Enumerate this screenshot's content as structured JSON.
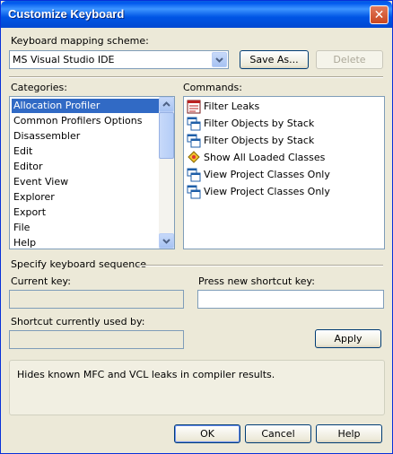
{
  "window": {
    "title": "Customize Keyboard",
    "close_glyph": "✕"
  },
  "mapping": {
    "label": "Keyboard mapping scheme:",
    "value": "MS Visual Studio IDE",
    "save_as_label": "Save As...",
    "delete_label": "Delete"
  },
  "categories": {
    "label": "Categories:",
    "items": [
      "Allocation Profiler",
      "Common Profilers Options",
      "Disassembler",
      "Edit",
      "Editor",
      "Event View",
      "Explorer",
      "Export",
      "File",
      "Help"
    ],
    "selected": "Allocation Profiler"
  },
  "commands": {
    "label": "Commands:",
    "items": [
      {
        "label": "Filter Leaks",
        "icon": "filter-leaks-icon"
      },
      {
        "label": "Filter Objects by Stack",
        "icon": "stack-windows-icon"
      },
      {
        "label": "Filter Objects by Stack",
        "icon": "stack-windows-icon"
      },
      {
        "label": "Show All Loaded Classes",
        "icon": "classes-icon"
      },
      {
        "label": "View Project Classes Only",
        "icon": "windows-icon"
      },
      {
        "label": "View Project Classes Only",
        "icon": "windows-icon"
      }
    ],
    "selected": "Filter Leaks"
  },
  "sequence": {
    "label": "Specify keyboard sequence",
    "current_key_label": "Current key:",
    "current_key_value": "",
    "new_key_label": "Press new shortcut key:",
    "new_key_value": "",
    "used_by_label": "Shortcut currently used by:",
    "used_by_value": "",
    "apply_label": "Apply"
  },
  "description": "Hides known MFC and VCL leaks in compiler results.",
  "footer": {
    "ok_label": "OK",
    "cancel_label": "Cancel",
    "help_label": "Help"
  },
  "colors": {
    "titlebar": "#0058ee",
    "dialog_bg": "#ece9d8",
    "selection": "#316ac5",
    "field_border": "#7f9db9"
  }
}
